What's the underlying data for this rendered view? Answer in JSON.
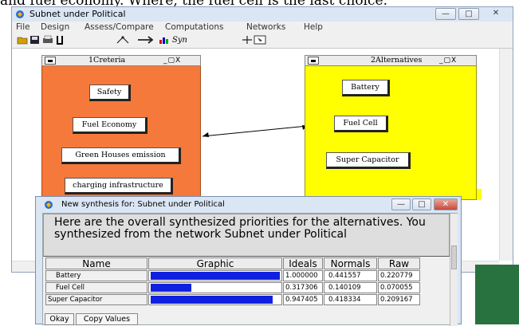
{
  "caption_fragment": "and fuel economy. Where, the fuel cell is the last choice.",
  "window": {
    "title": "Subnet under Political",
    "minimize": "—",
    "maximize": "□",
    "close": "✕"
  },
  "menu": [
    "File",
    "Design",
    "Assess/Compare",
    "Computations",
    "Networks",
    "Help"
  ],
  "toolbar": {
    "syn_label": "Syn"
  },
  "clusters": {
    "criteria": {
      "title": "1Creteria",
      "nodes": [
        "Safety",
        "Fuel Economy",
        "Green Houses emission",
        "charging infrastructure"
      ]
    },
    "alternatives": {
      "title": "2Alternatives",
      "nodes": [
        "Battery",
        "Fuel Cell",
        "Super Capacitor"
      ]
    },
    "window_buttons": "_▢X"
  },
  "dialog": {
    "title": "New synthesis for: Subnet under Political",
    "message": "Here are the overall synthesized priorities for the alternatives.  You synthesized from the network Subnet under Political",
    "columns": [
      "Name",
      "Graphic",
      "Ideals",
      "Normals",
      "Raw"
    ],
    "rows": [
      {
        "name": "Battery",
        "graphic": 1.0,
        "ideals": "1.000000",
        "normals": "0.441557",
        "raw": "0.220779"
      },
      {
        "name": "Fuel Cell",
        "graphic": 0.317306,
        "ideals": "0.317306",
        "normals": "0.140109",
        "raw": "0.070055"
      },
      {
        "name": "Super Capacitor",
        "graphic": 0.947405,
        "ideals": "0.947405",
        "normals": "0.418334",
        "raw": "0.209167"
      }
    ],
    "buttons": {
      "okay": "Okay",
      "copy_values": "Copy Values"
    }
  },
  "colors": {
    "criteria_cluster": "#f5793a",
    "alternatives_cluster": "#ffff00",
    "bar": "#1020e0"
  }
}
